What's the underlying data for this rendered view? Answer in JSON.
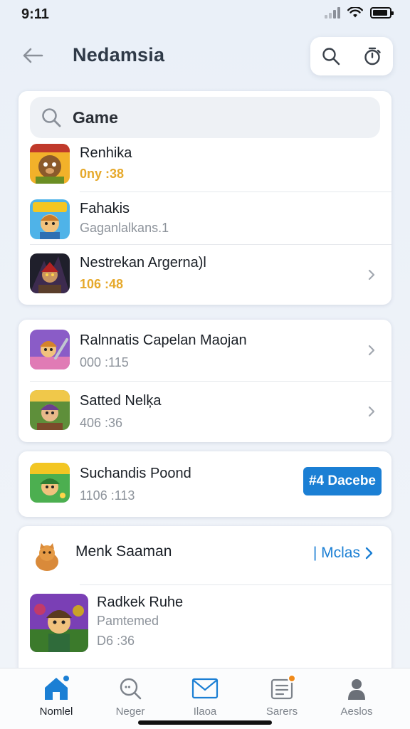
{
  "status_bar": {
    "time": "9:11"
  },
  "header": {
    "title": "Nedamsia"
  },
  "search": {
    "value": "Game",
    "placeholder": "Game"
  },
  "list1": [
    {
      "name": "Renhika",
      "meta": "0ny :38",
      "meta_style": "gold",
      "has_chevron": false
    },
    {
      "name": "Fahakis",
      "meta": "Gaganlalkans.1",
      "meta_style": "gray",
      "has_chevron": false
    },
    {
      "name": "Nestrekan Argerna)l",
      "meta": "106 :48",
      "meta_style": "gold",
      "has_chevron": true
    }
  ],
  "list2": [
    {
      "name": "Ralnnatis Capelan Maojan",
      "meta": "000 :115"
    },
    {
      "name": "Satted Nelķa",
      "meta": "406 :36"
    }
  ],
  "featured": {
    "name": "Suchandis Poond",
    "meta": "1106 :113",
    "button_label": "#4 Dacebe"
  },
  "section": {
    "title": "Menk Saaman",
    "more_label": "| Mclas",
    "item": {
      "name": "Radkek Ruhe",
      "subtitle": "Pamtemed",
      "meta": "D6 :36"
    }
  },
  "tabs": [
    {
      "label": "Nomlel",
      "icon": "home-icon",
      "active": true
    },
    {
      "label": "Neger",
      "icon": "discover-icon",
      "active": false
    },
    {
      "label": "Ilaoa",
      "icon": "mail-icon",
      "active": false
    },
    {
      "label": "Sarers",
      "icon": "list-icon",
      "active": false
    },
    {
      "label": "Aeslos",
      "icon": "profile-icon",
      "active": false
    }
  ],
  "colors": {
    "accent": "#1b7fd4",
    "gold": "#e6a92b",
    "badge": "#f08a1a"
  }
}
